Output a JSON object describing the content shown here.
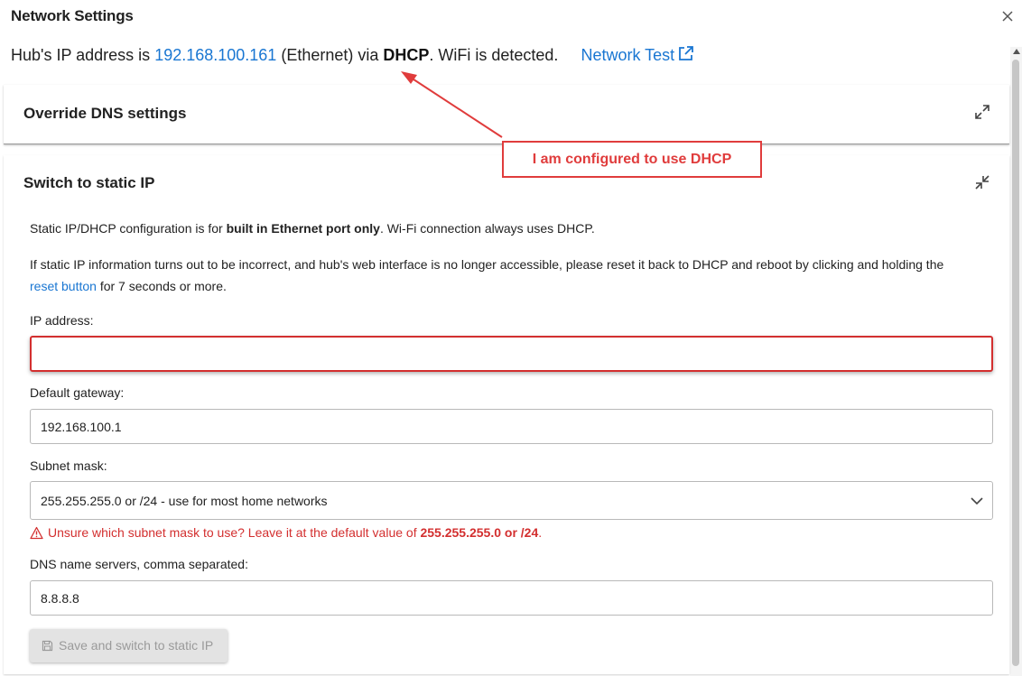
{
  "dialog": {
    "title": "Network Settings"
  },
  "status": {
    "prefix": "Hub's IP address is ",
    "ip": "192.168.100.161",
    "mid": " (Ethernet) via ",
    "method": "DHCP",
    "suffix": ".  WiFi is detected.",
    "network_test_label": "Network Test"
  },
  "panels": {
    "dns": {
      "title": "Override DNS settings"
    },
    "static": {
      "title": "Switch to static IP",
      "info_prefix": "Static IP/DHCP configuration is for ",
      "info_bold": "built in Ethernet port only",
      "info_suffix": ". Wi-Fi connection always uses DHCP.",
      "reset_text_1": "If static IP information turns out to be incorrect, and hub's web interface is no longer accessible, please reset it back to DHCP and reboot by clicking and holding the ",
      "reset_link": "reset button",
      "reset_text_2": " for 7 seconds or more.",
      "ip_label": "IP address:",
      "ip_value": "",
      "gateway_label": "Default gateway:",
      "gateway_value": "192.168.100.1",
      "subnet_label": "Subnet mask:",
      "subnet_selected": "255.255.255.0 or /24 - use for most home networks",
      "warning_prefix": "Unsure which subnet mask to use? Leave it at the default value of ",
      "warning_bold": "255.255.255.0 or /24",
      "warning_suffix": ".",
      "dns_label": "DNS name servers, comma separated:",
      "dns_value": "8.8.8.8",
      "save_label": "Save and switch to static IP"
    }
  },
  "annotation": {
    "text": "I am configured to use DHCP",
    "color": "#e03c3c"
  },
  "icons": {
    "close": "close-icon",
    "external_link": "external-link-icon",
    "expand": "expand-icon",
    "collapse": "collapse-icon",
    "chevron": "chevron-down-icon",
    "warning": "warning-icon",
    "save": "save-icon"
  },
  "colors": {
    "link": "#1976d2",
    "error": "#d32f2f"
  }
}
